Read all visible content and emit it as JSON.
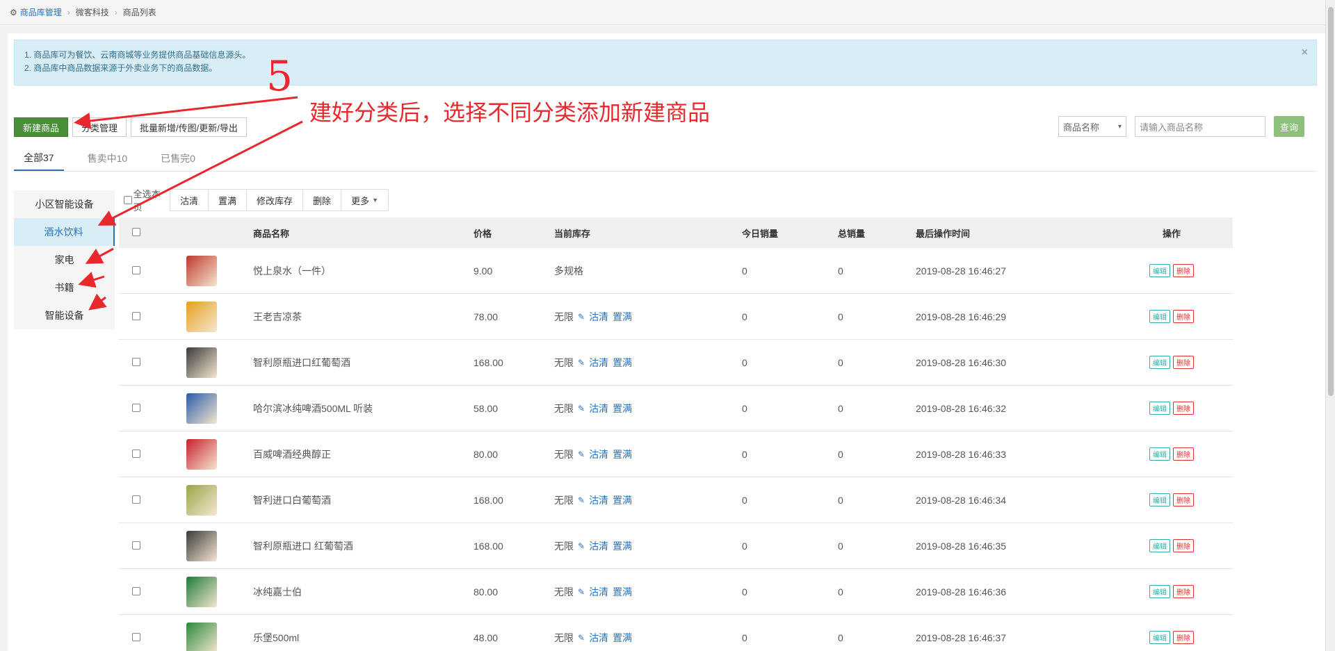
{
  "breadcrumb": {
    "home": "商品库管理",
    "mid": "微客科技",
    "current": "商品列表"
  },
  "alert": {
    "line1": "1. 商品库可为餐饮、云南商城等业务提供商品基础信息源头。",
    "line2": "2. 商品库中商品数据来源于外卖业务下的商品数据。",
    "close": "×"
  },
  "toolbar": {
    "new": "新建商品",
    "category": "分类管理",
    "batch": "批量新增/传图/更新/导出"
  },
  "search": {
    "select": "商品名称",
    "placeholder": "请输入商品名称",
    "query": "查询"
  },
  "tabs": [
    "全部37",
    "售卖中10",
    "已售完0"
  ],
  "categories": [
    "小区智能设备",
    "酒水饮料",
    "家电",
    "书籍",
    "智能设备"
  ],
  "actions": {
    "select_page": "全选本页",
    "clear": "沽清",
    "full": "置满",
    "modify": "修改库存",
    "delete": "删除",
    "more": "更多"
  },
  "table": {
    "headers": {
      "name": "商品名称",
      "price": "价格",
      "stock": "当前库存",
      "today": "今日销量",
      "total": "总销量",
      "time": "最后操作时间",
      "op": "操作"
    },
    "stock_clear": "沽清",
    "stock_full": "置满",
    "op_edit": "编辑",
    "op_delete": "删除",
    "rows": [
      {
        "name": "悦上泉水（一件）",
        "price": "9.00",
        "stock": "多规格",
        "today": "0",
        "total": "0",
        "time": "2019-08-28 16:46:27",
        "color": "#c0392b"
      },
      {
        "name": "王老吉凉茶",
        "price": "78.00",
        "stock": "无限",
        "today": "0",
        "total": "0",
        "time": "2019-08-28 16:46:29",
        "color": "#e6a01e"
      },
      {
        "name": "智利原瓶进口红葡萄酒",
        "price": "168.00",
        "stock": "无限",
        "today": "0",
        "total": "0",
        "time": "2019-08-28 16:46:30",
        "color": "#3b3a3a"
      },
      {
        "name": "哈尔滨冰纯啤酒500ML 听装",
        "price": "58.00",
        "stock": "无限",
        "today": "0",
        "total": "0",
        "time": "2019-08-28 16:46:32",
        "color": "#2a5ca8"
      },
      {
        "name": "百威啤酒经典醇正",
        "price": "80.00",
        "stock": "无限",
        "today": "0",
        "total": "0",
        "time": "2019-08-28 16:46:33",
        "color": "#c8202a"
      },
      {
        "name": "智利进口白葡萄酒",
        "price": "168.00",
        "stock": "无限",
        "today": "0",
        "total": "0",
        "time": "2019-08-28 16:46:34",
        "color": "#9aa54a"
      },
      {
        "name": "智利原瓶进口 红葡萄酒",
        "price": "168.00",
        "stock": "无限",
        "today": "0",
        "total": "0",
        "time": "2019-08-28 16:46:35",
        "color": "#3b3a3a"
      },
      {
        "name": "冰纯嘉士伯",
        "price": "80.00",
        "stock": "无限",
        "today": "0",
        "total": "0",
        "time": "2019-08-28 16:46:36",
        "color": "#1e7a3a"
      },
      {
        "name": "乐堡500ml",
        "price": "48.00",
        "stock": "无限",
        "today": "0",
        "total": "0",
        "time": "2019-08-28 16:46:37",
        "color": "#2a8a3a"
      }
    ]
  },
  "annotation": {
    "number": "5",
    "text": "建好分类后，选择不同分类添加新建商品"
  },
  "colors": {
    "primary": "#4a8e3a",
    "link": "#2a72b8",
    "annotation": "#e8282d"
  }
}
